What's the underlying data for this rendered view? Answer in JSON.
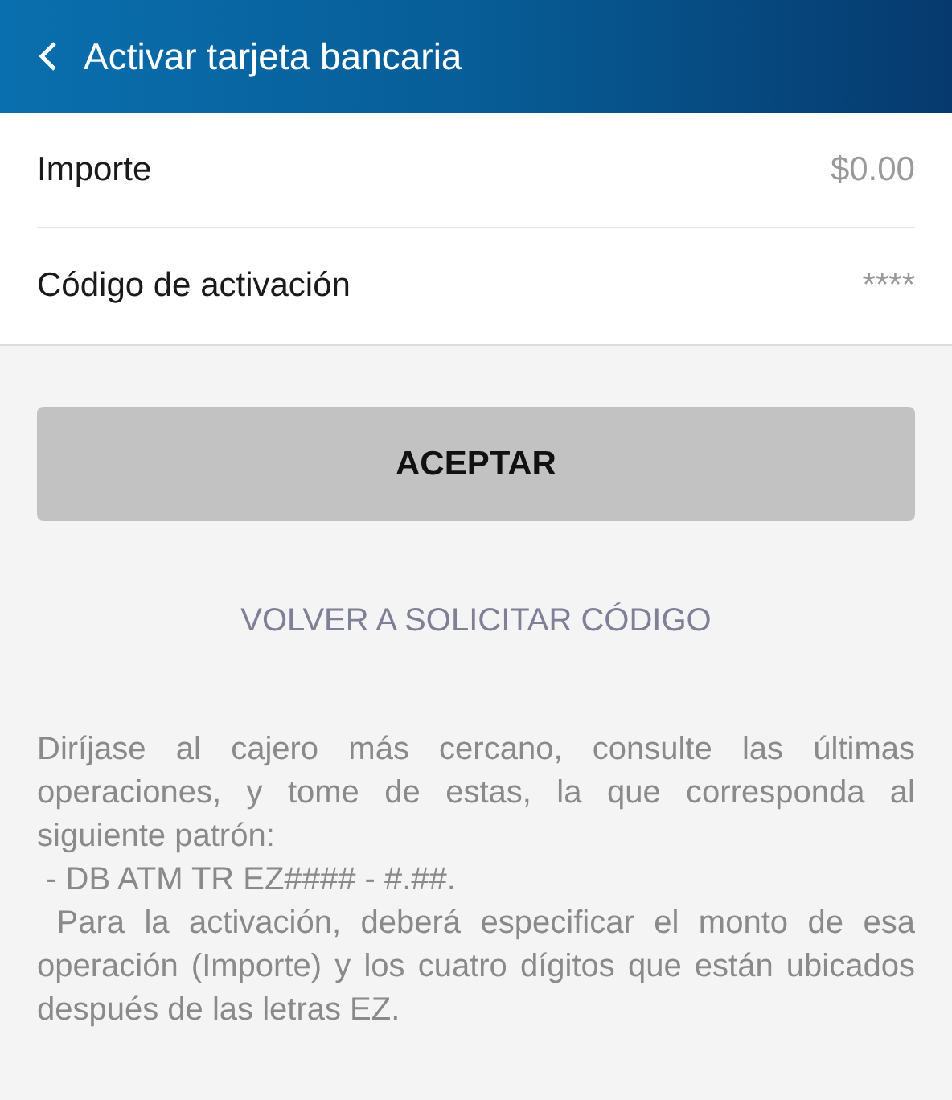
{
  "app_bar": {
    "title": "Activar tarjeta bancaria"
  },
  "fields": [
    {
      "label": "Importe",
      "placeholder": "$0.00"
    },
    {
      "label": "Código de activación",
      "placeholder": "****"
    }
  ],
  "accept_button": {
    "label": "ACEPTAR",
    "disabled": true
  },
  "resend_link": "VOLVER A SOLICITAR CÓDIGO",
  "instructions": [
    "Diríjase al cajero más cercano, consulte las últimas operaciones, y tome de estas, la que corresponda al siguiente patrón:",
    " - DB ATM TR EZ#### - #.##.",
    " Para la activación, deberá especificar el monto de esa operación (Importe) y los cuatro dígitos que están ubicados después de las letras EZ."
  ]
}
